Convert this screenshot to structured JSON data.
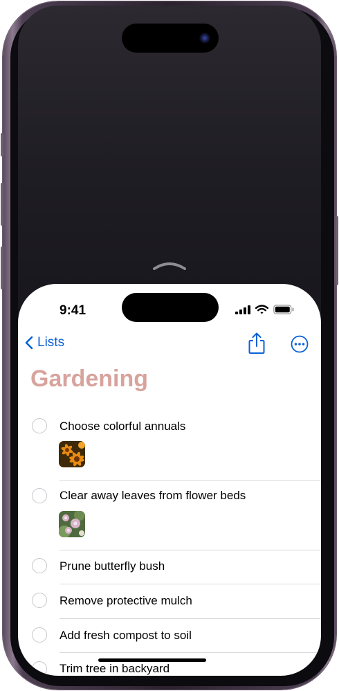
{
  "status_bar": {
    "time": "9:41"
  },
  "nav": {
    "back_label": "Lists"
  },
  "list": {
    "title": "Gardening",
    "title_color": "#d8a39d",
    "items": [
      {
        "text": "Choose colorful annuals",
        "thumbnail": "orange-flowers-image"
      },
      {
        "text": "Clear away leaves from flower beds",
        "thumbnail": "pink-flowers-image"
      },
      {
        "text": "Prune butterfly bush"
      },
      {
        "text": "Remove protective mulch"
      },
      {
        "text": "Add fresh compost to soil"
      },
      {
        "text": "Trim tree in backyard"
      }
    ]
  },
  "colors": {
    "accent": "#0a60d8",
    "frame": "#2b222e"
  }
}
